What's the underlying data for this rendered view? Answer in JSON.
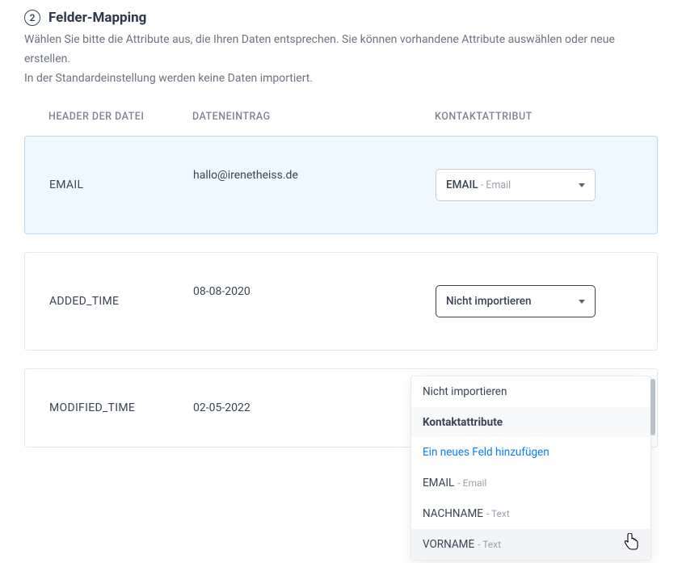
{
  "step": "2",
  "title": "Felder-Mapping",
  "description_line1": "Wählen Sie bitte die Attribute aus, die Ihren Daten entsprechen. Sie können vorhandene Attribute auswählen oder neue erstellen.",
  "description_line2": "In der Standardeinstellung werden keine Daten importiert.",
  "columns": {
    "header": "HEADER DER DATEI",
    "data": "DATENEINTRAG",
    "attribute": "KONTAKTATTRIBUT"
  },
  "rows": [
    {
      "header": "EMAIL",
      "data": "hallo@irenetheiss.de",
      "select_value": "EMAIL",
      "select_sub": " - Email"
    },
    {
      "header": "ADDED_TIME",
      "data": "08-08-2020",
      "select_value": "Nicht importieren",
      "select_sub": ""
    },
    {
      "header": "MODIFIED_TIME",
      "data": "02-05-2022",
      "select_value": "",
      "select_sub": ""
    }
  ],
  "dropdown": {
    "option_no_import": "Nicht importieren",
    "group_label": "Kontaktattribute",
    "link_new_field": "Ein neues Feld hinzufügen",
    "items": [
      {
        "label": "EMAIL",
        "sub": " - Email"
      },
      {
        "label": "NACHNAME",
        "sub": " - Text"
      },
      {
        "label": "VORNAME",
        "sub": " - Text"
      }
    ]
  }
}
